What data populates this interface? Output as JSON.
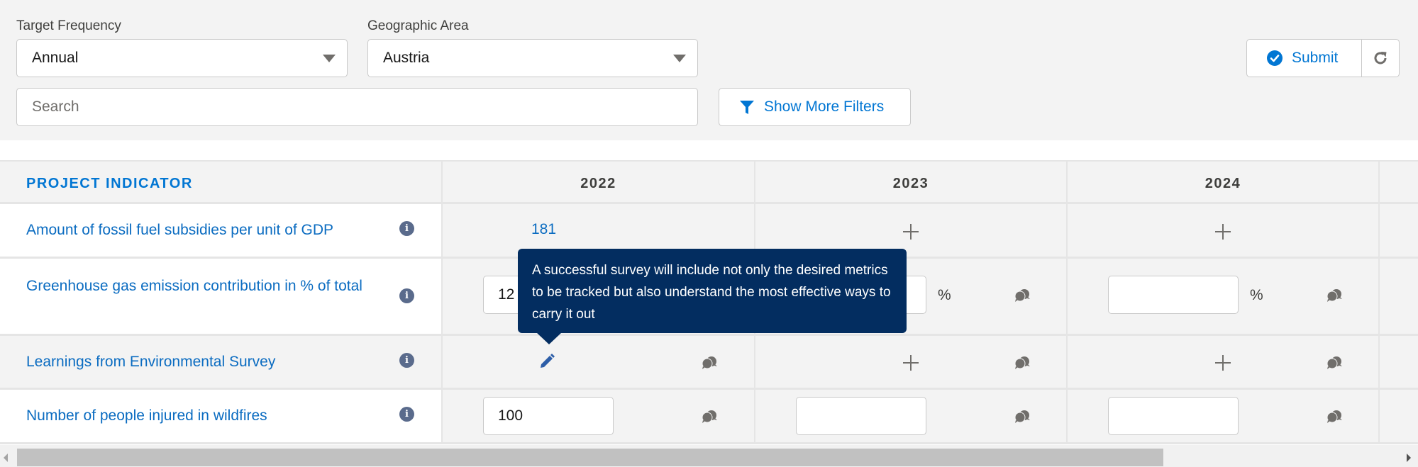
{
  "filters": {
    "target_frequency": {
      "label": "Target Frequency",
      "value": "Annual"
    },
    "geographic_area": {
      "label": "Geographic Area",
      "value": "Austria"
    },
    "search": {
      "placeholder": "Search",
      "value": ""
    },
    "show_more_filters_label": "Show More Filters",
    "submit_label": "Submit"
  },
  "icons": {
    "select_caret": "chevron-down-icon",
    "filter": "funnel-icon",
    "submit": "check-circle-icon",
    "refresh": "refresh-icon",
    "info": "info-icon",
    "comment": "chat-bubbles-icon",
    "edit": "pencil-icon",
    "add": "plus-icon"
  },
  "colors": {
    "brand": "#0176d3",
    "link": "#0b6cc1",
    "tooltip_bg": "#032d60",
    "info_icon": "#5a6b8c",
    "icon_grey": "#706e6b"
  },
  "table": {
    "header": {
      "indicator_label": "PROJECT INDICATOR",
      "years": [
        "2022",
        "2023",
        "2024"
      ]
    },
    "rows": [
      {
        "indicator": "Amount of fossil fuel subsidies per unit of GDP",
        "cells": [
          {
            "type": "link",
            "value": "181"
          },
          {
            "type": "add"
          },
          {
            "type": "add"
          }
        ]
      },
      {
        "indicator": "Greenhouse gas emission contribution in % of total",
        "unit": "%",
        "cells": [
          {
            "type": "input",
            "value": "12"
          },
          {
            "type": "input",
            "value": ""
          },
          {
            "type": "input",
            "value": ""
          }
        ]
      },
      {
        "indicator": "Learnings from Environmental Survey",
        "cells": [
          {
            "type": "edit"
          },
          {
            "type": "add"
          },
          {
            "type": "add"
          }
        ]
      },
      {
        "indicator": "Number of people injured in wildfires",
        "cells": [
          {
            "type": "input",
            "value": "100"
          },
          {
            "type": "input",
            "value": ""
          },
          {
            "type": "input",
            "value": ""
          }
        ]
      }
    ]
  },
  "tooltip": {
    "text": "A successful survey will include not only the desired metrics to be tracked but also understand the most effective ways to carry it out"
  }
}
